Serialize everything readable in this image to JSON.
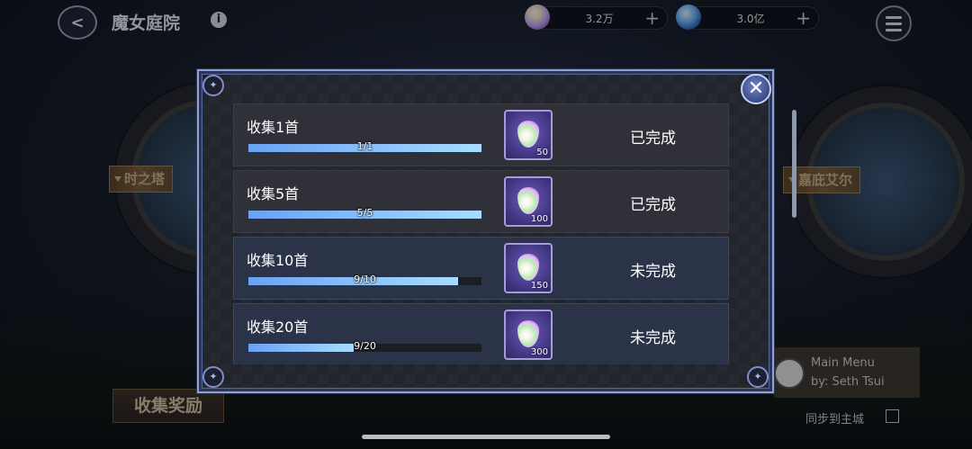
{
  "header": {
    "title": "魔女庭院",
    "currencies": [
      {
        "icon": "crystal-gem-icon",
        "value": "3.2万"
      },
      {
        "icon": "blue-orb-icon",
        "value": "3.0亿"
      }
    ]
  },
  "background": {
    "left_location": "时之塔",
    "right_location": "嘉庇艾尔",
    "reward_button": "收集奖励",
    "music": {
      "line1": "Main Menu",
      "line2": "by: Seth Tsui"
    },
    "sync_label": "同步到主城"
  },
  "modal": {
    "rows": [
      {
        "title": "收集1首",
        "progress_text": "1/1",
        "progress": 1.0,
        "reward_qty": "50",
        "status": "已完成",
        "completed": true
      },
      {
        "title": "收集5首",
        "progress_text": "5/5",
        "progress": 1.0,
        "reward_qty": "100",
        "status": "已完成",
        "completed": true
      },
      {
        "title": "收集10首",
        "progress_text": "9/10",
        "progress": 0.9,
        "reward_qty": "150",
        "status": "未完成",
        "completed": false
      },
      {
        "title": "收集20首",
        "progress_text": "9/20",
        "progress": 0.45,
        "reward_qty": "300",
        "status": "未完成",
        "completed": false
      }
    ]
  }
}
